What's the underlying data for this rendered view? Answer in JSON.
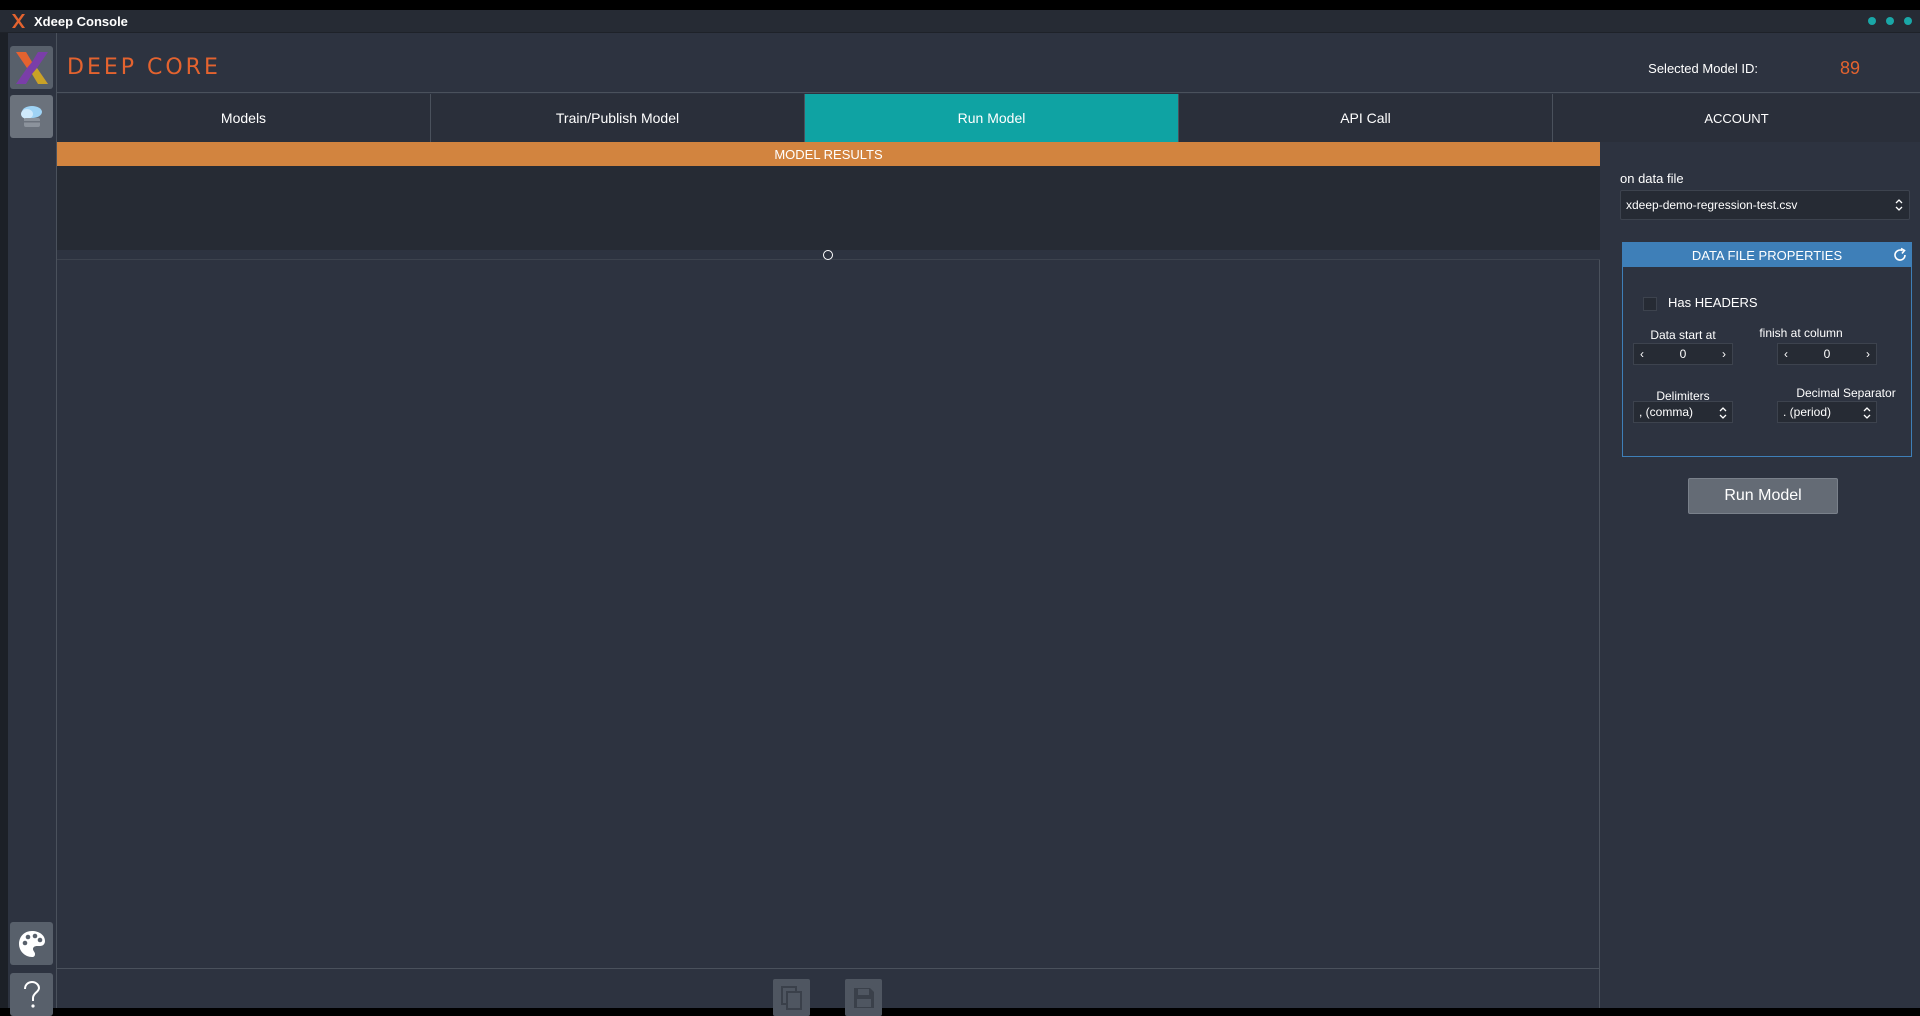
{
  "window": {
    "title": "Xdeep Console"
  },
  "header": {
    "logo_text": "DEEP CORE",
    "model_id_label": "Selected Model ID:",
    "model_id_value": "89"
  },
  "tabs": [
    {
      "label": "Models",
      "active": false
    },
    {
      "label": "Train/Publish Model",
      "active": false
    },
    {
      "label": "Run Model",
      "active": true
    },
    {
      "label": "API Call",
      "active": false
    },
    {
      "label": "ACCOUNT",
      "active": false
    }
  ],
  "results": {
    "header": "MODEL RESULTS"
  },
  "right_panel": {
    "data_file_label": "on data file",
    "data_file_value": "xdeep-demo-regression-test.csv",
    "props_title": "DATA FILE PROPERTIES",
    "has_headers_label": "Has HEADERS",
    "has_headers_checked": false,
    "data_start_label": "Data start at",
    "data_start_value": "0",
    "finish_col_label": "finish at column",
    "finish_col_value": "0",
    "delimiters_label": "Delimiters",
    "delimiters_value": ", (comma)",
    "decimal_sep_label": "Decimal Separator",
    "decimal_sep_value": ". (period)",
    "run_button": "Run Model"
  },
  "colors": {
    "accent_teal": "#0fa3a3",
    "accent_orange": "#e4632f",
    "results_header": "#d2843f",
    "props_blue": "#3e7fb8"
  },
  "icons": [
    "app-x-icon",
    "models-logo-icon",
    "cloud-db-icon",
    "palette-icon",
    "help-icon",
    "copy-icon",
    "save-icon",
    "refresh-icon"
  ]
}
